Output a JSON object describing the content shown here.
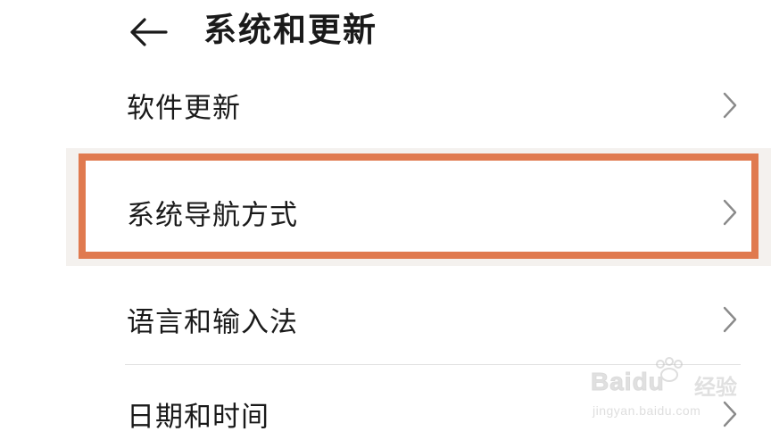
{
  "header": {
    "title": "系统和更新",
    "back_icon": "arrow-left-icon"
  },
  "settings": {
    "items": [
      {
        "label": "软件更新",
        "icon": "chevron-right-icon"
      },
      {
        "label": "系统导航方式",
        "icon": "chevron-right-icon",
        "highlighted": true
      },
      {
        "label": "语言和输入法",
        "icon": "chevron-right-icon"
      },
      {
        "label": "日期和时间",
        "icon": "chevron-right-icon"
      }
    ]
  },
  "colors": {
    "highlight_border": "#e07a4f",
    "text": "#1a1a1a",
    "chevron": "#8a8a8a",
    "divider": "#e2e2e2"
  },
  "watermark": {
    "brand": "Bai",
    "brand_suffix": "du",
    "product": "经验",
    "url": "jingyan.baidu.com"
  }
}
